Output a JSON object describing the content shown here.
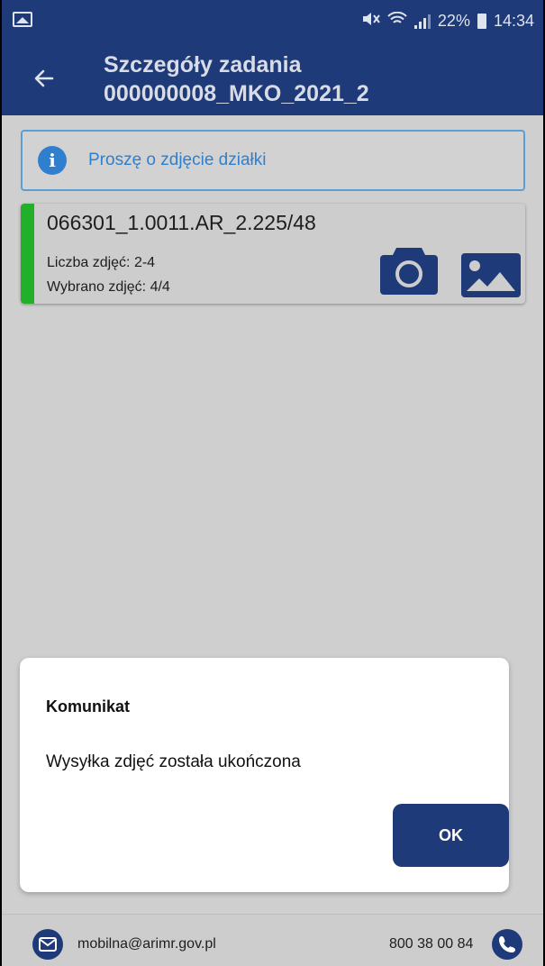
{
  "status_bar": {
    "battery": "22%",
    "time": "14:34"
  },
  "app_bar": {
    "title_line1": "Szczegóły zadania",
    "title_line2": "000000008_MKO_2021_2"
  },
  "info": {
    "message": "Proszę o zdjęcie działki"
  },
  "parcel": {
    "name": "066301_1.0011.AR_2.225/48",
    "photo_count": "Liczba zdjęć: 2-4",
    "selected": "Wybrano zdjęć: 4/4"
  },
  "dialog": {
    "title": "Komunikat",
    "message": "Wysyłka zdjęć została ukończona",
    "ok_label": "OK"
  },
  "footer": {
    "email": "mobilna@arimr.gov.pl",
    "phone": "800 38 00 84"
  },
  "colors": {
    "brand": "#1f3a78",
    "info": "#2f7fce",
    "status_ok": "#22b02a"
  }
}
